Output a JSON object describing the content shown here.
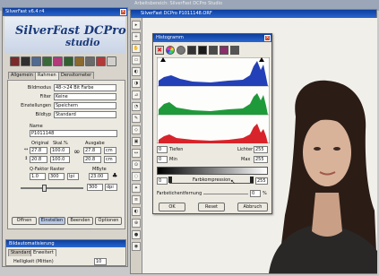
{
  "panel": {
    "title": "SilverFast v6.4 r4",
    "brand_name": "SilverFast DCPro",
    "brand_sub": "studio",
    "tabs": [
      "Allgemein",
      "Rahmen",
      "Densitometer"
    ],
    "rows": [
      {
        "label": "Bildmodus",
        "value": "48->24 Bit Farbe"
      },
      {
        "label": "Filter",
        "value": "Keine"
      },
      {
        "label": "Einstellungen",
        "value": "Speichern"
      },
      {
        "label": "Bildtyp",
        "value": "Standard"
      }
    ],
    "name_label": "Name",
    "name_value": "P1011148",
    "size_headers": [
      "Original",
      "Skal.%",
      "Ausgabe"
    ],
    "width_in": "27.8",
    "width_scale": "100.0",
    "width_out": "27.8",
    "height_in": "20.8",
    "height_scale": "100.0",
    "height_out": "20.8",
    "unit": "cm",
    "qf_header": "Q-Faktor Raster",
    "qf_value": "1.0",
    "raster_value": "300",
    "raster_unit": "lpi",
    "mbyte_label": "MByte",
    "mbyte_value": "23.00",
    "res_value": "300",
    "res_unit": "dpi",
    "buttons": [
      "Öffnen",
      "Einstellen",
      "Beenden",
      "Optionen"
    ],
    "lower_title": "Bildautomatisierung",
    "lower_tabs": [
      "Standard",
      "Erweitert"
    ],
    "lower_row_label": "Helligkeit (Mitten)",
    "lower_row_value": "10"
  },
  "preview": {
    "bg_title": "Arbeitsbereich: SilverFast DCPro Studio",
    "title": "SilverFast DCPro P1011148.ORF",
    "tools": [
      "▸",
      "+",
      "✋",
      "▭",
      "◐",
      "◑",
      "⊿",
      "◔",
      "✎",
      "◇",
      "▣",
      "↔",
      "⊙",
      "◌",
      "✦",
      "≡",
      "◐",
      "⊕",
      "●",
      "◉"
    ],
    "accent_blue": "#0c3e9e",
    "photo_bg": "#f1efea"
  },
  "histogram": {
    "title": "Histogramm",
    "icons": [
      "stop-icon",
      "color-wheel-icon",
      "gray-icon",
      "channel-icon",
      "black-point-icon",
      "white-point-icon",
      "color-icon",
      "mode-icon"
    ],
    "tiefen_value": "0",
    "tiefen_label": "Tiefen",
    "lichter_label": "Lichter",
    "lichter_value": "255",
    "min_value": "0",
    "min_label": "Min",
    "max_label": "Max",
    "max_value": "255",
    "kompression_left": "0",
    "kompression_label": "Farbkompression",
    "kompression_right": "255",
    "farbstich_label": "Farbstichentfernung",
    "farbstich_value": "0",
    "farbstich_unit": "%",
    "buttons": [
      "OK",
      "Reset",
      "Abbruch"
    ],
    "channels": [
      {
        "name": "red",
        "color": "#d8232a"
      },
      {
        "name": "green",
        "color": "#1f9a3a"
      },
      {
        "name": "blue",
        "color": "#2440b8"
      }
    ]
  }
}
